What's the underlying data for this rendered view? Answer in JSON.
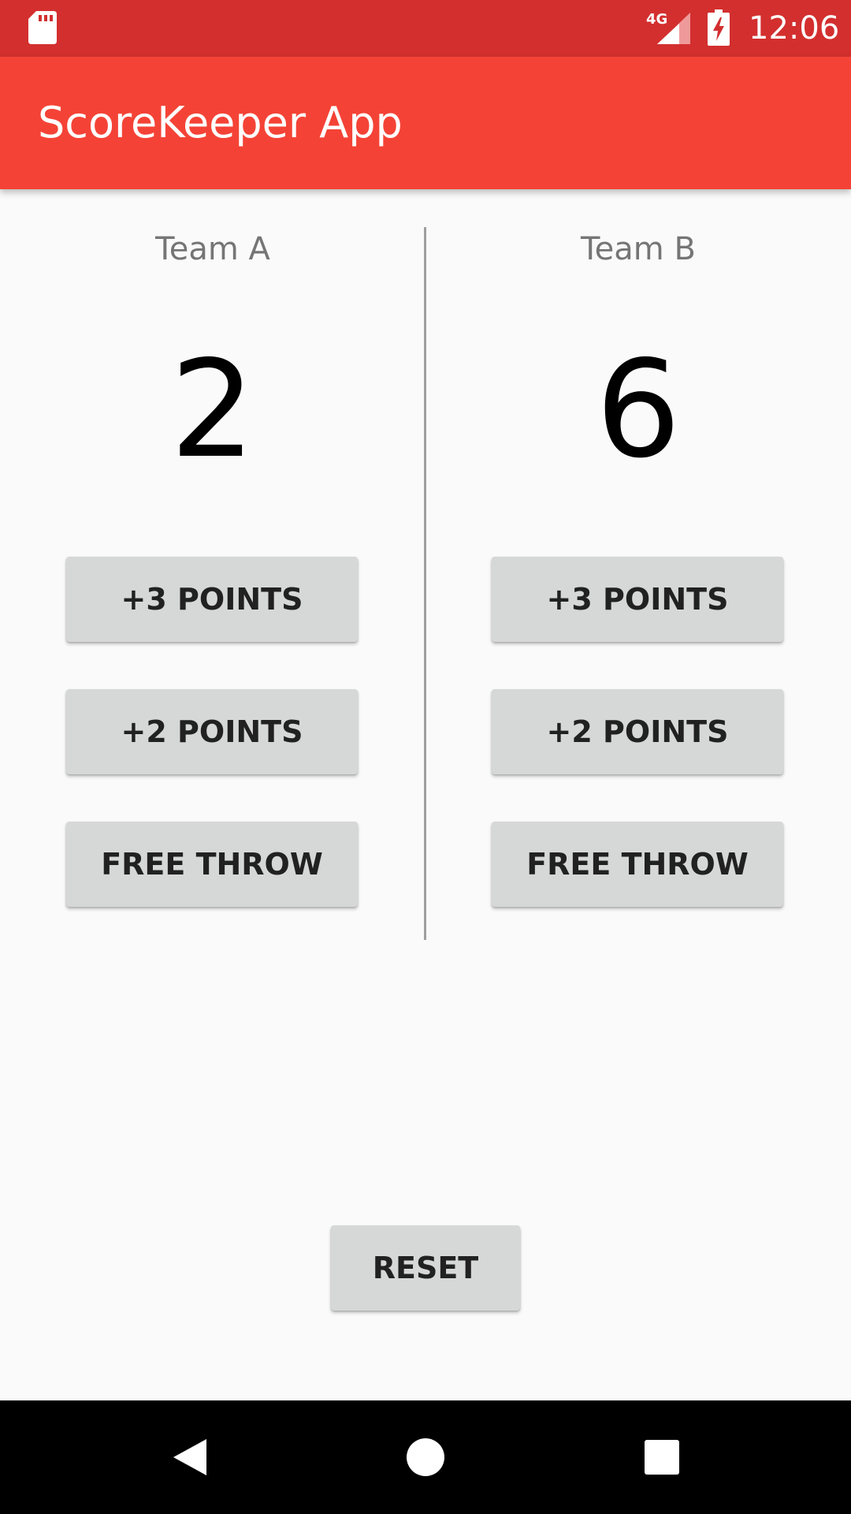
{
  "status_bar": {
    "time": "12:06",
    "network": "4G",
    "icons": [
      "sd-card-icon",
      "signal-icon",
      "battery-charging-icon"
    ]
  },
  "app_bar": {
    "title": "ScoreKeeper App"
  },
  "teams": [
    {
      "name": "Team A",
      "score": "2",
      "buttons": {
        "three": "+3 POINTS",
        "two": "+2 POINTS",
        "free_throw": "FREE THROW"
      }
    },
    {
      "name": "Team B",
      "score": "6",
      "buttons": {
        "three": "+3 POINTS",
        "two": "+2 POINTS",
        "free_throw": "FREE THROW"
      }
    }
  ],
  "reset_label": "RESET",
  "nav_bar": {
    "icons": [
      "back-icon",
      "home-icon",
      "recents-icon"
    ]
  },
  "colors": {
    "status_bar": "#d32f2f",
    "app_bar": "#f44336",
    "button": "#d6d7d7",
    "background": "#fafafa"
  }
}
